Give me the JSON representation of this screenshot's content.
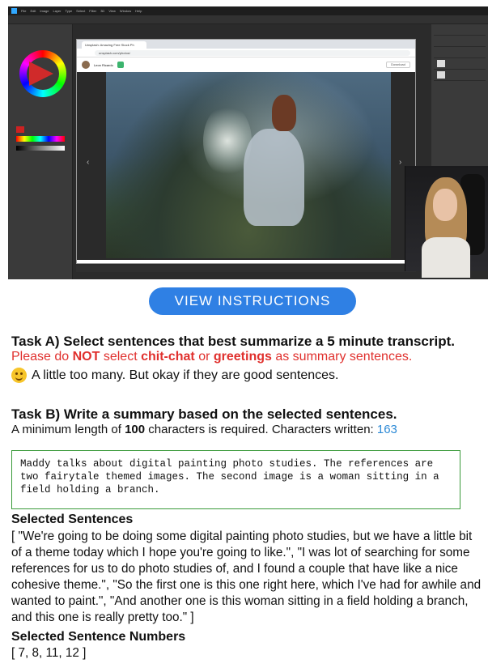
{
  "video": {
    "ps_menu": [
      "File",
      "Edit",
      "Image",
      "Layer",
      "Type",
      "Select",
      "Filter",
      "3D",
      "View",
      "Window",
      "Help"
    ],
    "browser_tab": "Unsplash: Amazing Free Stock Ph",
    "browser_url": "unsplash.com/photos/",
    "photographer": "Leon Ricardo",
    "download_label": "Download"
  },
  "instructions_button": "VIEW INSTRUCTIONS",
  "task_a": {
    "title": "Task A) Select sentences that best summarize a 5 minute transcript.",
    "warning_pre": "Please do ",
    "warning_not": "NOT",
    "warning_mid": " select ",
    "warning_chitchat": "chit-chat",
    "warning_or": " or ",
    "warning_greetings": "greetings",
    "warning_post": " as summary sentences.",
    "feedback": "A little too many. But okay if they are good sentences."
  },
  "task_b": {
    "title": "Task B) Write a summary based on the selected sentences.",
    "req_pre": "A minimum length of ",
    "req_min": "100",
    "req_post": " characters is required. Characters written: ",
    "chars_written": "163",
    "summary_text": "Maddy talks about digital painting photo studies. The references are two fairytale themed images. The second image is a woman sitting in a field holding a branch."
  },
  "selected_sentences": {
    "title": "Selected Sentences",
    "text": "[ \"We're going to be doing some digital painting photo studies, but we have a little bit of a theme today which I hope you're going to like.\", \"I was lot of searching for some references for us to do photo studies of, and I found a couple that have like a nice cohesive theme.\", \"So the first one is this one right here, which I've had for awhile and wanted to paint.\", \"And another one is this woman sitting in a field holding a branch, and this one is really pretty too.\" ]"
  },
  "selected_numbers": {
    "title": "Selected Sentence Numbers",
    "text": "[ 7, 8, 11, 12 ]"
  },
  "colors": {
    "button": "#2f80e4",
    "warning": "#e0302d",
    "count": "#2d8ad6",
    "textbox_border": "#3a9a3a"
  }
}
